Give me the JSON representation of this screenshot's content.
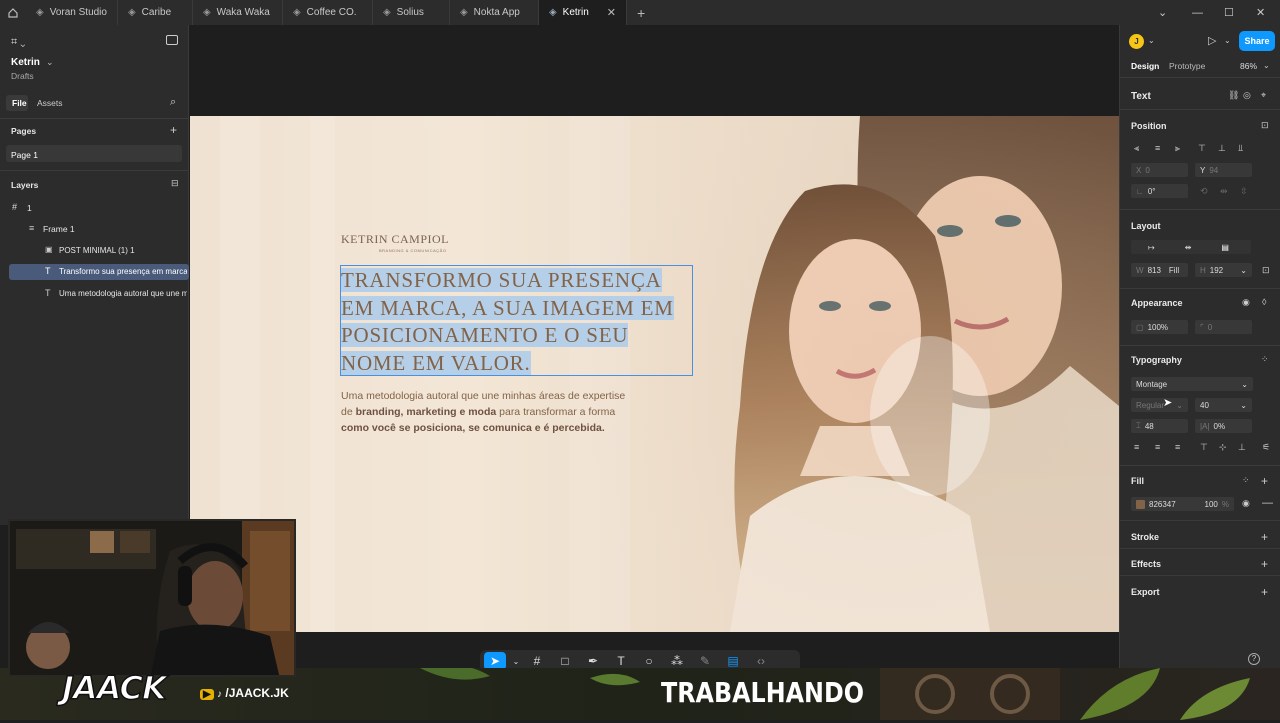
{
  "tabs": [
    {
      "label": "Voran Studio"
    },
    {
      "label": "Caribe"
    },
    {
      "label": "Waka Waka"
    },
    {
      "label": "Coffee CO."
    },
    {
      "label": "Solius"
    },
    {
      "label": "Nokta App"
    },
    {
      "label": "Ketrin",
      "active": true
    }
  ],
  "file": {
    "name": "Ketrin",
    "location": "Drafts"
  },
  "left_tabs": {
    "file": "File",
    "assets": "Assets"
  },
  "pages": {
    "header": "Pages",
    "items": [
      "Page 1"
    ]
  },
  "layers": {
    "header": "Layers",
    "items": [
      {
        "label": "1",
        "icon": "frame-icon"
      },
      {
        "label": "Frame 1",
        "icon": "autolayout-icon"
      },
      {
        "label": "POST MINIMAL (1) 1",
        "icon": "image-icon"
      },
      {
        "label": "Transformo sua presença em marca,",
        "icon": "text-icon",
        "selected": true
      },
      {
        "label": "Uma metodologia autoral que une mi",
        "icon": "text-icon"
      }
    ]
  },
  "artboard": {
    "brand_name": "KETRIN CAMPIOL",
    "brand_sub": "BRANDING & COMUNICAÇÃO",
    "headline_lines": [
      "TRANSFORMO SUA PRESENÇA",
      "EM MARCA, A SUA IMAGEM EM",
      "POSICIONAMENTO E O SEU",
      "NOME EM VALOR."
    ],
    "body_l1": "Uma metodologia autoral que une minhas áreas de expertise",
    "body_l2_a": "de ",
    "body_l2_b": "branding, marketing e moda",
    "body_l2_c": " para transformar a forma",
    "body_l3": "como você se posiciona, se comunica e é percebida."
  },
  "right": {
    "avatar_letter": "J",
    "share": "Share",
    "tab_design": "Design",
    "tab_prototype": "Prototype",
    "zoom": "86%",
    "section_text": "Text",
    "position": {
      "header": "Position",
      "x_label": "X",
      "x": "0",
      "y_label": "Y",
      "y": "94",
      "rotation": "0°"
    },
    "layout": {
      "header": "Layout",
      "w_label": "W",
      "w": "813",
      "w_mode": "Fill",
      "h_label": "H",
      "h": "192"
    },
    "appearance": {
      "header": "Appearance",
      "opacity": "100%",
      "radius": "0"
    },
    "typography": {
      "header": "Typography",
      "font": "Montage",
      "weight": "Regular",
      "size": "40",
      "line_height": "48",
      "letter_spacing": "0%"
    },
    "fill": {
      "header": "Fill",
      "hex": "826347",
      "opacity": "100",
      "unit": "%"
    },
    "stroke": "Stroke",
    "effects": "Effects",
    "export": "Export"
  },
  "stream": {
    "logo": "JAACK",
    "handle": "/JAACK.JK",
    "status": "TRABALHANDO"
  },
  "colors": {
    "accent": "#0d99ff",
    "fill": "#826347",
    "selection": "#4a5a7a"
  }
}
